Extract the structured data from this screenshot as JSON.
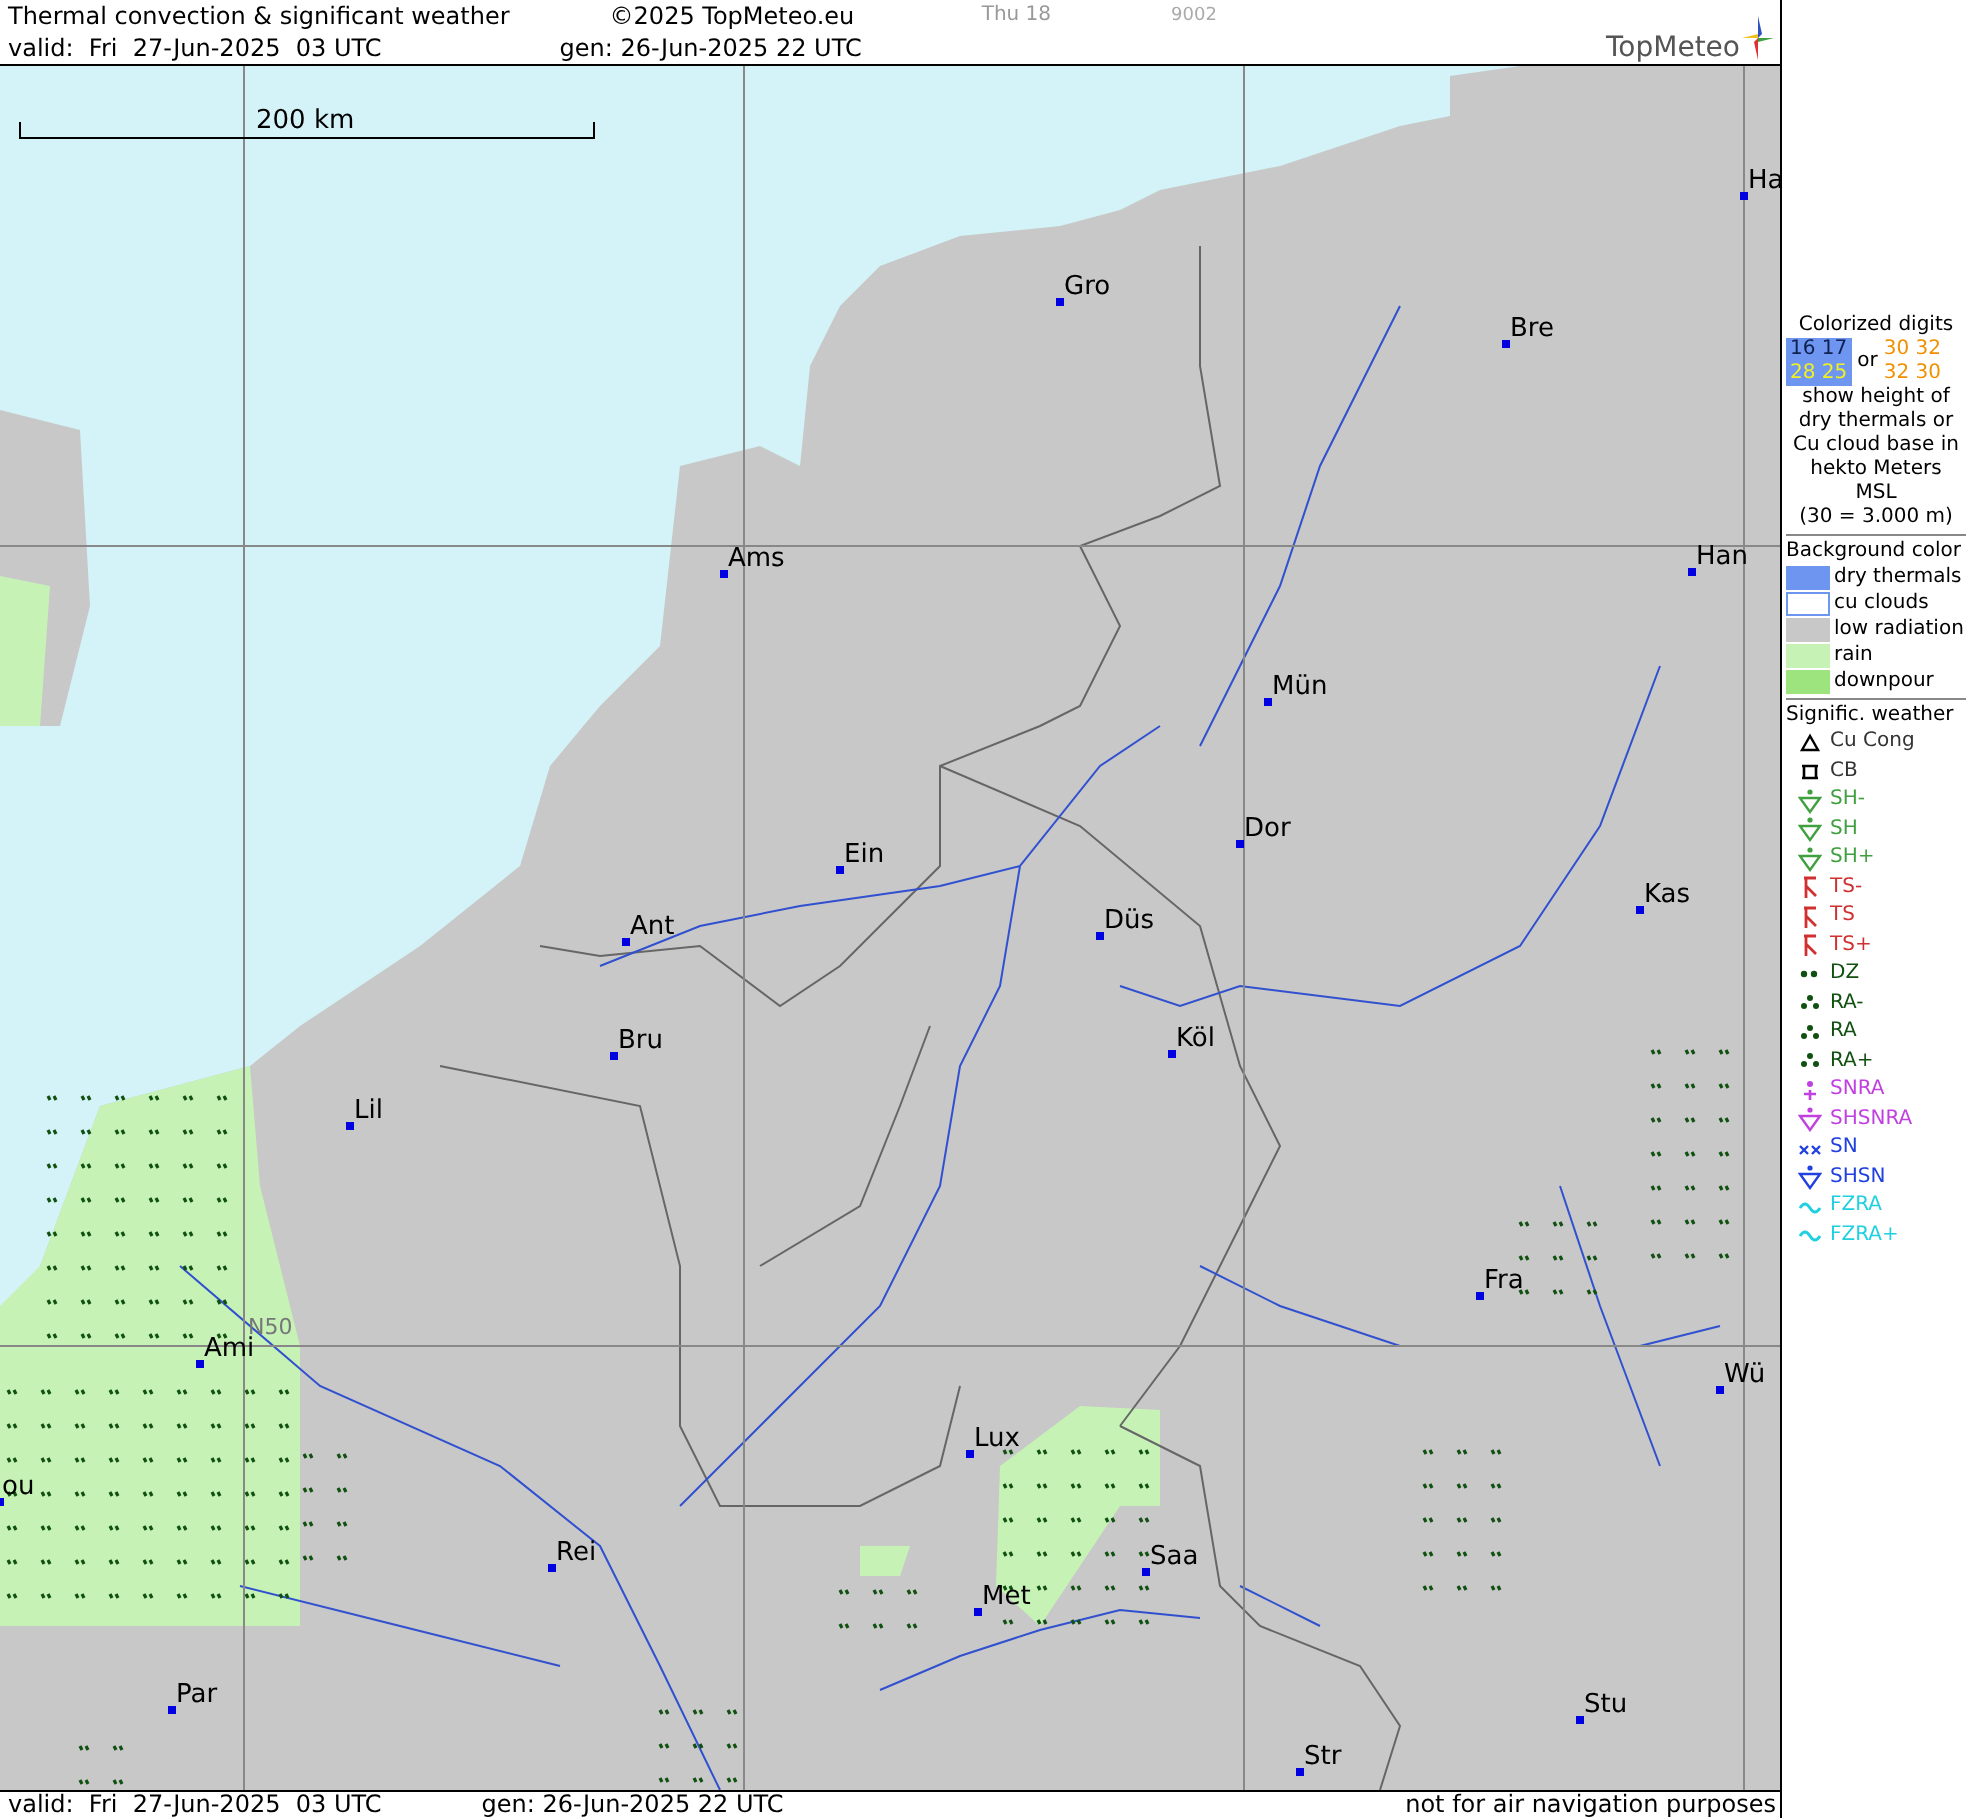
{
  "header": {
    "title": "Thermal convection & significant weather",
    "copyright": "©2025 TopMeteo.eu",
    "day": "Thu 18",
    "code": "9002",
    "valid": "valid:  Fri  27-Jun-2025  03 UTC",
    "gen": "gen: 26-Jun-2025 22 UTC"
  },
  "logo": {
    "text": "TopMeteo"
  },
  "map": {
    "scale": "200 km",
    "grid_label": "N50",
    "cities": [
      "Ha",
      "Gro",
      "Bre",
      "Ams",
      "Han",
      "Mün",
      "Dor",
      "Ein",
      "Kas",
      "Ant",
      "Düs",
      "Bru",
      "Köl",
      "Lil",
      "Fra",
      "Ami",
      "Wü",
      "Lux",
      "ou",
      "Rei",
      "Saa",
      "Met",
      "Par",
      "Stu",
      "Str"
    ]
  },
  "legend": {
    "digits_title": "Colorized digits",
    "blue_digits": [
      "16 17",
      "28 25"
    ],
    "or": "or",
    "orange_digits": [
      "30 32",
      "32 30"
    ],
    "description": "show height of dry thermals or Cu cloud base in hekto Meters MSL",
    "example": "(30 = 3.000 m)",
    "background_title": "Background color",
    "backgrounds": [
      {
        "label": "dry thermals",
        "color": "#6e96f0"
      },
      {
        "label": "cu clouds",
        "color": "#ffffff"
      },
      {
        "label": "low radiation",
        "color": "#c8c8c8"
      },
      {
        "label": "rain",
        "color": "#c6f2b6"
      },
      {
        "label": "downpour",
        "color": "#9ee47e"
      }
    ],
    "weather_title": "Signific. weather",
    "weather": [
      {
        "kind": "cloud",
        "label": "Cu Cong",
        "color": "#000000"
      },
      {
        "kind": "cb",
        "label": "CB",
        "color": "#000000"
      },
      {
        "kind": "shower",
        "label": "SH-",
        "color": "#40a040"
      },
      {
        "kind": "shower",
        "label": "SH",
        "color": "#40a040"
      },
      {
        "kind": "shower",
        "label": "SH+",
        "color": "#40a040"
      },
      {
        "kind": "thunder",
        "label": "TS-",
        "color": "#d03030"
      },
      {
        "kind": "thunder",
        "label": "TS",
        "color": "#d03030"
      },
      {
        "kind": "thunder",
        "label": "TS+",
        "color": "#d03030"
      },
      {
        "kind": "drizzle",
        "label": "DZ",
        "color": "#105010"
      },
      {
        "kind": "rain",
        "label": "RA-",
        "color": "#105010"
      },
      {
        "kind": "rain",
        "label": "RA",
        "color": "#105010"
      },
      {
        "kind": "rain",
        "label": "RA+",
        "color": "#105010"
      },
      {
        "kind": "snowrain",
        "label": "SNRA",
        "color": "#c040e0"
      },
      {
        "kind": "shower",
        "label": "SHSNRA",
        "color": "#c040e0"
      },
      {
        "kind": "snow",
        "label": "SN",
        "color": "#2040e0"
      },
      {
        "kind": "shower",
        "label": "SHSN",
        "color": "#2040e0"
      },
      {
        "kind": "freezing",
        "label": "FZRA",
        "color": "#20d0e0"
      },
      {
        "kind": "freezing",
        "label": "FZRA+",
        "color": "#20d0e0"
      }
    ]
  },
  "footer": {
    "valid": "valid:  Fri  27-Jun-2025  03 UTC",
    "gen": "gen: 26-Jun-2025 22 UTC",
    "disclaimer": "not for air navigation purposes"
  }
}
